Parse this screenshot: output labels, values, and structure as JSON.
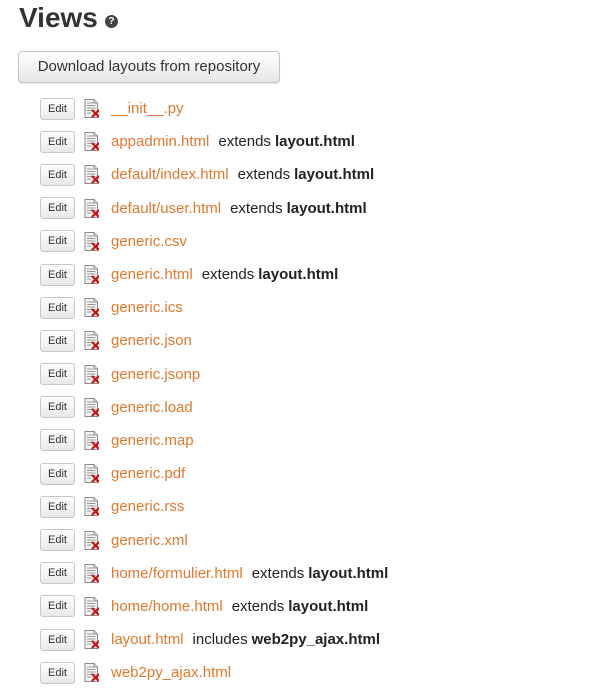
{
  "header": {
    "title": "Views",
    "help_icon": "question-circle-icon",
    "help_glyph": "?"
  },
  "toolbar": {
    "download_label": "Download layouts from repository"
  },
  "views": [
    {
      "edit_label": "Edit",
      "delete_icon": "delete-file-icon",
      "name": "__init__.py",
      "relation": "",
      "target": ""
    },
    {
      "edit_label": "Edit",
      "delete_icon": "delete-file-icon",
      "name": "appadmin.html",
      "relation": "extends",
      "target": "layout.html"
    },
    {
      "edit_label": "Edit",
      "delete_icon": "delete-file-icon",
      "name": "default/index.html",
      "relation": "extends",
      "target": "layout.html"
    },
    {
      "edit_label": "Edit",
      "delete_icon": "delete-file-icon",
      "name": "default/user.html",
      "relation": "extends",
      "target": "layout.html"
    },
    {
      "edit_label": "Edit",
      "delete_icon": "delete-file-icon",
      "name": "generic.csv",
      "relation": "",
      "target": ""
    },
    {
      "edit_label": "Edit",
      "delete_icon": "delete-file-icon",
      "name": "generic.html",
      "relation": "extends",
      "target": "layout.html"
    },
    {
      "edit_label": "Edit",
      "delete_icon": "delete-file-icon",
      "name": "generic.ics",
      "relation": "",
      "target": ""
    },
    {
      "edit_label": "Edit",
      "delete_icon": "delete-file-icon",
      "name": "generic.json",
      "relation": "",
      "target": ""
    },
    {
      "edit_label": "Edit",
      "delete_icon": "delete-file-icon",
      "name": "generic.jsonp",
      "relation": "",
      "target": ""
    },
    {
      "edit_label": "Edit",
      "delete_icon": "delete-file-icon",
      "name": "generic.load",
      "relation": "",
      "target": ""
    },
    {
      "edit_label": "Edit",
      "delete_icon": "delete-file-icon",
      "name": "generic.map",
      "relation": "",
      "target": ""
    },
    {
      "edit_label": "Edit",
      "delete_icon": "delete-file-icon",
      "name": "generic.pdf",
      "relation": "",
      "target": ""
    },
    {
      "edit_label": "Edit",
      "delete_icon": "delete-file-icon",
      "name": "generic.rss",
      "relation": "",
      "target": ""
    },
    {
      "edit_label": "Edit",
      "delete_icon": "delete-file-icon",
      "name": "generic.xml",
      "relation": "",
      "target": ""
    },
    {
      "edit_label": "Edit",
      "delete_icon": "delete-file-icon",
      "name": "home/formulier.html",
      "relation": "extends",
      "target": "layout.html"
    },
    {
      "edit_label": "Edit",
      "delete_icon": "delete-file-icon",
      "name": "home/home.html",
      "relation": "extends",
      "target": "layout.html"
    },
    {
      "edit_label": "Edit",
      "delete_icon": "delete-file-icon",
      "name": "layout.html",
      "relation": "includes",
      "target": "web2py_ajax.html"
    },
    {
      "edit_label": "Edit",
      "delete_icon": "delete-file-icon",
      "name": "web2py_ajax.html",
      "relation": "",
      "target": ""
    }
  ],
  "colors": {
    "link": "#e0782e",
    "text": "#222222",
    "title": "#333333",
    "delete_mark": "#cc1111"
  }
}
